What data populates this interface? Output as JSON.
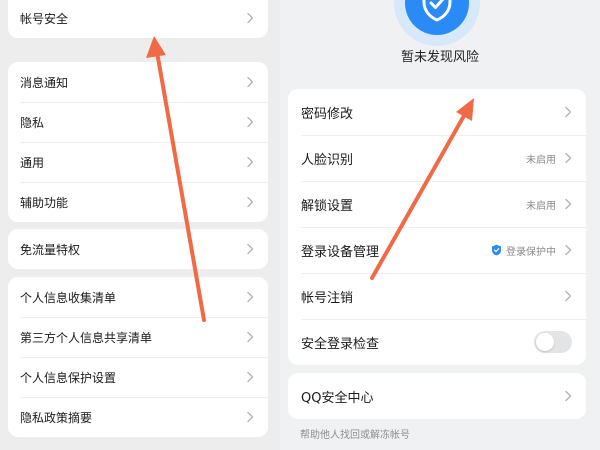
{
  "left_panel": {
    "group1": [
      {
        "label": "帐号安全"
      }
    ],
    "group2": [
      {
        "label": "消息通知"
      },
      {
        "label": "隐私"
      },
      {
        "label": "通用"
      },
      {
        "label": "辅助功能"
      }
    ],
    "group3": [
      {
        "label": "免流量特权"
      }
    ],
    "group4": [
      {
        "label": "个人信息收集清单"
      },
      {
        "label": "第三方个人信息共享清单"
      },
      {
        "label": "个人信息保护设置"
      },
      {
        "label": "隐私政策摘要"
      }
    ]
  },
  "right_panel": {
    "status_title": "暂未发现风险",
    "items": [
      {
        "label": "密码修改",
        "value": ""
      },
      {
        "label": "人脸识别",
        "value": "未启用"
      },
      {
        "label": "解锁设置",
        "value": "未启用"
      },
      {
        "label": "登录设备管理",
        "value": "登录保护中"
      },
      {
        "label": "帐号注销",
        "value": ""
      },
      {
        "label": "安全登录检查",
        "toggle": false
      }
    ],
    "qq_center": {
      "label": "QQ安全中心"
    },
    "helper_text": "帮助他人找回或解冻帐号"
  },
  "colors": {
    "accent_blue": "#2a8af6",
    "arrow": "#f06a45"
  }
}
